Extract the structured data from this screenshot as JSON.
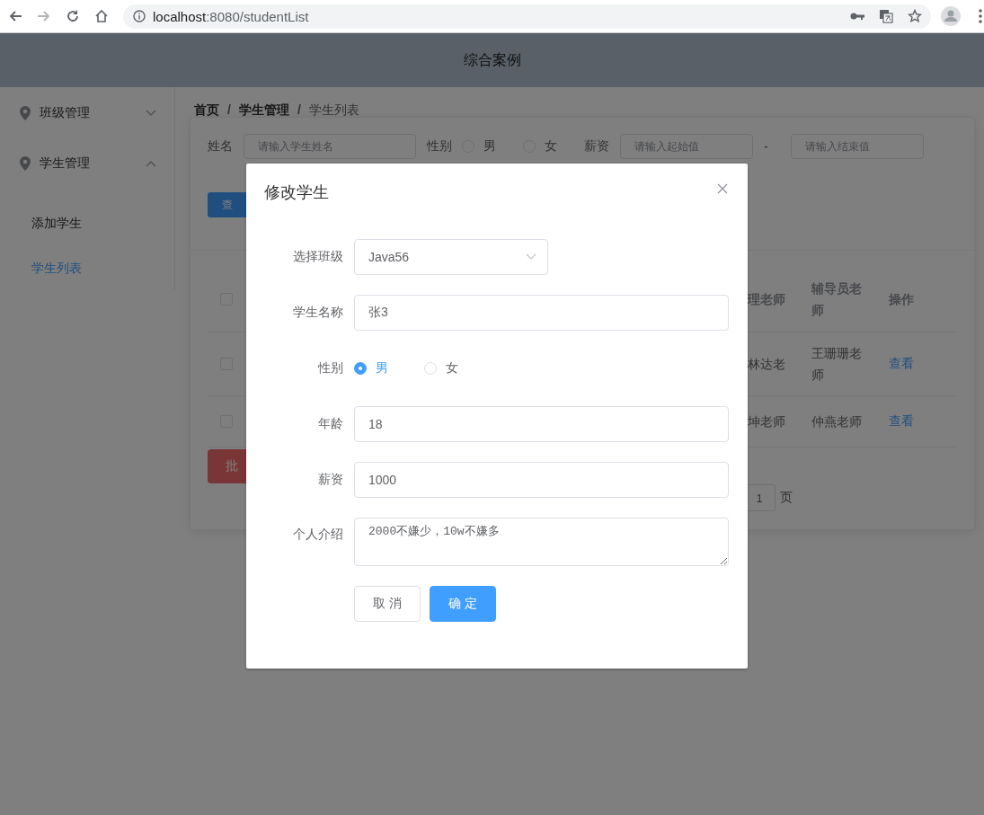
{
  "browser": {
    "url_host": "localhost",
    "url_path": ":8080/studentList"
  },
  "header": {
    "title": "综合案例"
  },
  "sidebar": {
    "menus": [
      {
        "label": "班级管理",
        "expanded": false
      },
      {
        "label": "学生管理",
        "expanded": true,
        "children": [
          {
            "label": "添加学生",
            "selected": false
          },
          {
            "label": "学生列表",
            "selected": true
          }
        ]
      }
    ]
  },
  "breadcrumb": {
    "items": [
      {
        "label": "首页",
        "current": false
      },
      {
        "label": "学生管理",
        "current": false
      },
      {
        "label": "学生列表",
        "current": true
      }
    ],
    "separators": [
      "/",
      "/"
    ]
  },
  "search": {
    "name_label": "姓名",
    "name_placeholder": "请输入学生姓名",
    "gender_label": "性别",
    "gender_options": [
      {
        "label": "男",
        "selected": false
      },
      {
        "label": "女",
        "selected": false
      }
    ],
    "salary_label": "薪资",
    "salary_min_placeholder": "请输入起始值",
    "range_separator": "-",
    "salary_max_placeholder": "请输入结束值",
    "query_button": "查"
  },
  "table": {
    "header_checked": false,
    "columns": [
      "理老师",
      "辅导员老师",
      "操作"
    ],
    "rows": [
      {
        "checked": false,
        "cells": [
          "林达老",
          "王珊珊老师",
          "查看"
        ]
      },
      {
        "checked": false,
        "cells": [
          "坤老师",
          "仲燕老师",
          "查看"
        ]
      }
    ]
  },
  "batch_delete_button": "批",
  "pagination": {
    "page": "1",
    "unit": "页"
  },
  "dialog": {
    "title": "修改学生",
    "fields": [
      {
        "kind": "select",
        "label": "选择班级",
        "value": "Java56"
      },
      {
        "kind": "text",
        "label": "学生名称",
        "value": "张3"
      },
      {
        "kind": "radio",
        "label": "性别",
        "options": [
          {
            "label": "男",
            "selected": true
          },
          {
            "label": "女",
            "selected": false
          }
        ]
      },
      {
        "kind": "text",
        "label": "年龄",
        "value": "18"
      },
      {
        "kind": "text",
        "label": "薪资",
        "value": "1000"
      },
      {
        "kind": "textarea",
        "label": "个人介绍",
        "value": "2000不嫌少，10w不嫌多"
      }
    ],
    "buttons": [
      {
        "kind": "default",
        "label": "取 消"
      },
      {
        "kind": "primary",
        "label": "确 定"
      }
    ]
  }
}
